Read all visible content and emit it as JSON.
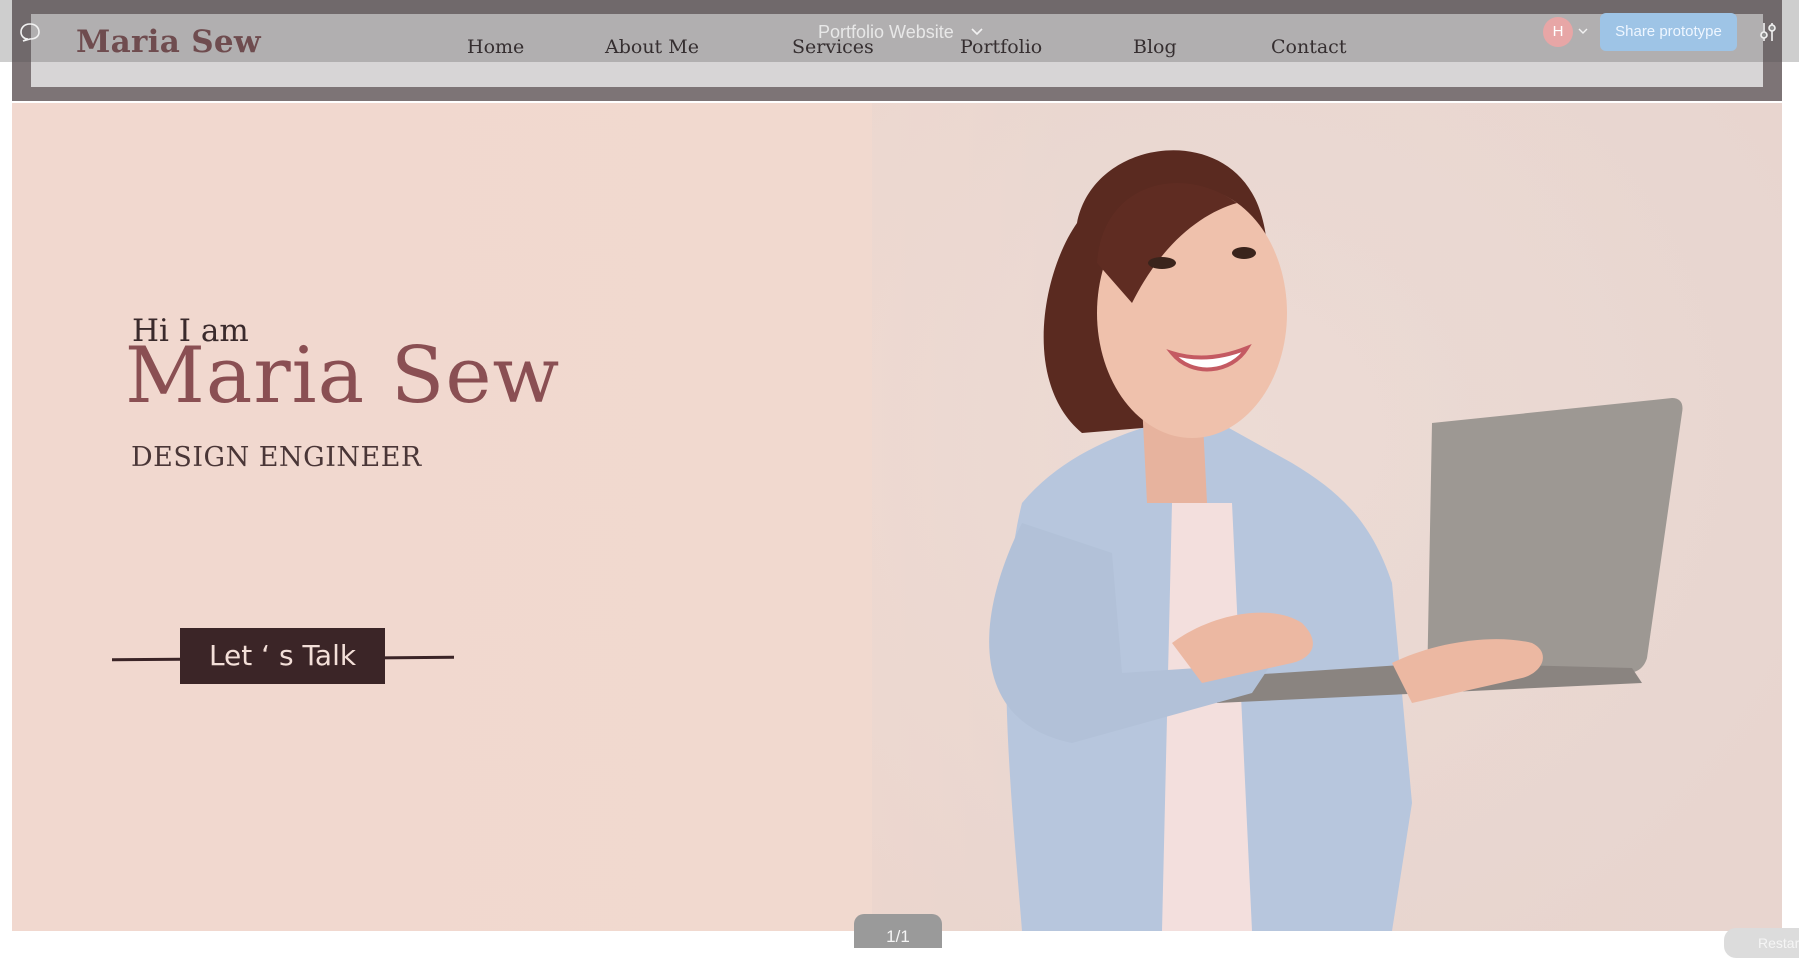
{
  "site": {
    "brand": "Maria Sew",
    "nav": [
      "Home",
      "About Me",
      "Services",
      "Portfolio",
      "Blog",
      "Contact"
    ]
  },
  "hero": {
    "greeting": "Hi I am",
    "name": "Maria Sew",
    "role": "DESIGN ENGINEER",
    "cta": "Let ‘ s Talk"
  },
  "viewer": {
    "file_title": "Portfolio Website",
    "avatar_initial": "H",
    "share_label": "Share prototype",
    "page_counter": "1/1",
    "restart_label": "Restart"
  },
  "colors": {
    "accent": "#8a4f53",
    "button": "#3b2527",
    "hero_bg": "#f1d8cf",
    "share": "#9ec4e6"
  },
  "icons": [
    "comment-icon",
    "chevron-down-icon",
    "settings-sliders-icon",
    "restart-icon"
  ]
}
